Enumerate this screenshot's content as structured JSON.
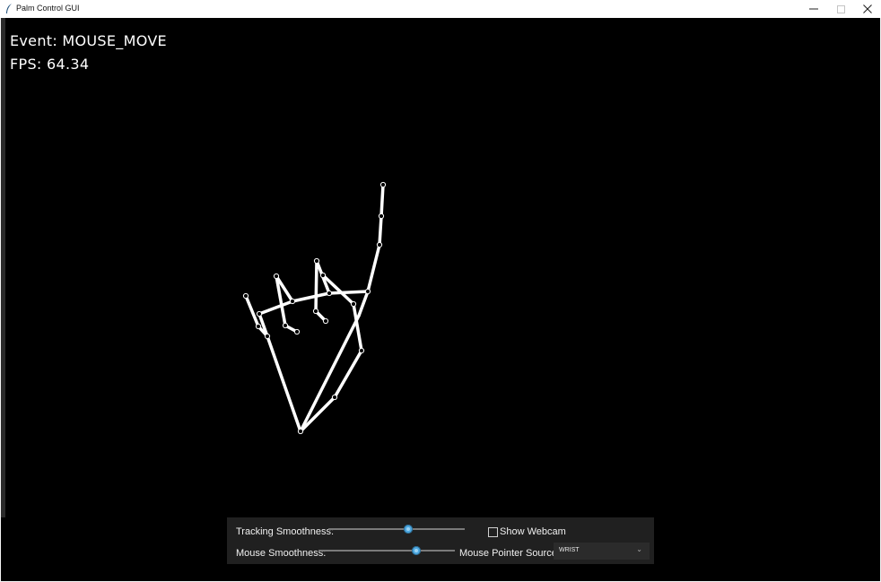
{
  "window": {
    "title": "Palm Control GUI",
    "minimize_icon": "minimize-icon",
    "maximize_icon": "maximize-icon",
    "close_icon": "close-icon"
  },
  "overlay": {
    "event_label": "Event:",
    "event_value": "MOUSE_MOVE",
    "fps_label": "FPS:",
    "fps_value": "64.34"
  },
  "controls": {
    "tracking_smoothness": {
      "label": "Tracking Smoothness:",
      "level": 0.59
    },
    "show_webcam": {
      "label": "Show Webcam",
      "checked": false
    },
    "mouse_smoothness": {
      "label": "Mouse Smoothness:",
      "level": 0.73
    },
    "mouse_pointer_source": {
      "label": "Mouse Pointer Source:",
      "value": "WRIST"
    }
  },
  "colors": {
    "canvas_bg": "#000000",
    "skeleton": "#ffffff",
    "panel_bg": "#202020",
    "slider_thumb": "#4ea8e0"
  }
}
